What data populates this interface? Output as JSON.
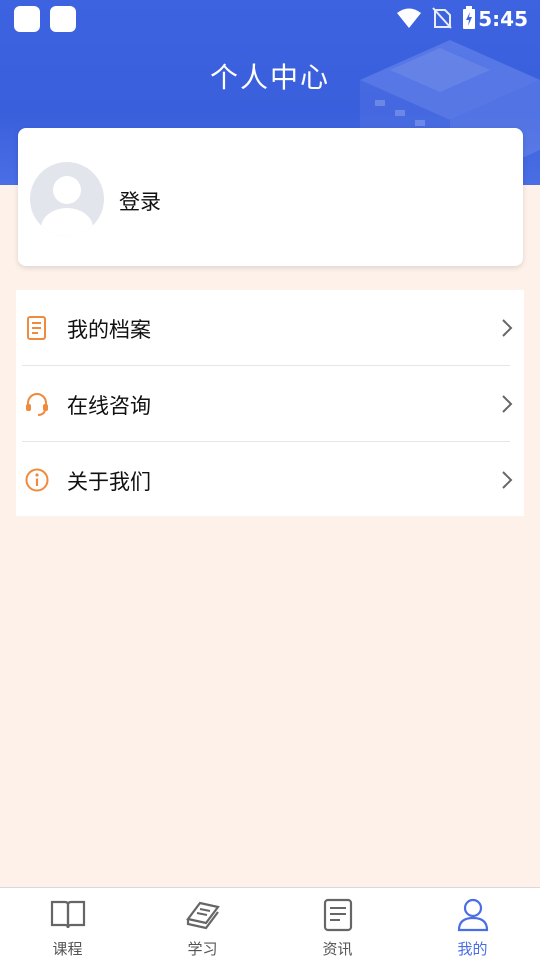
{
  "status_bar": {
    "time": "5:45"
  },
  "header": {
    "title": "个人中心"
  },
  "profile": {
    "login_label": "登录"
  },
  "menu": {
    "items": [
      {
        "label": "我的档案",
        "icon": "document-icon"
      },
      {
        "label": "在线咨询",
        "icon": "headset-icon"
      },
      {
        "label": "关于我们",
        "icon": "info-icon"
      }
    ]
  },
  "tabbar": {
    "tabs": [
      {
        "label": "课程",
        "icon": "open-book-icon",
        "active": false
      },
      {
        "label": "学习",
        "icon": "book-stack-icon",
        "active": false
      },
      {
        "label": "资讯",
        "icon": "news-icon",
        "active": false
      },
      {
        "label": "我的",
        "icon": "user-icon",
        "active": true
      }
    ]
  },
  "colors": {
    "primary": "#3d63e0",
    "accent_orange": "#f08a3c",
    "background": "#fdf1ea",
    "active_tab": "#4a6ee4"
  }
}
